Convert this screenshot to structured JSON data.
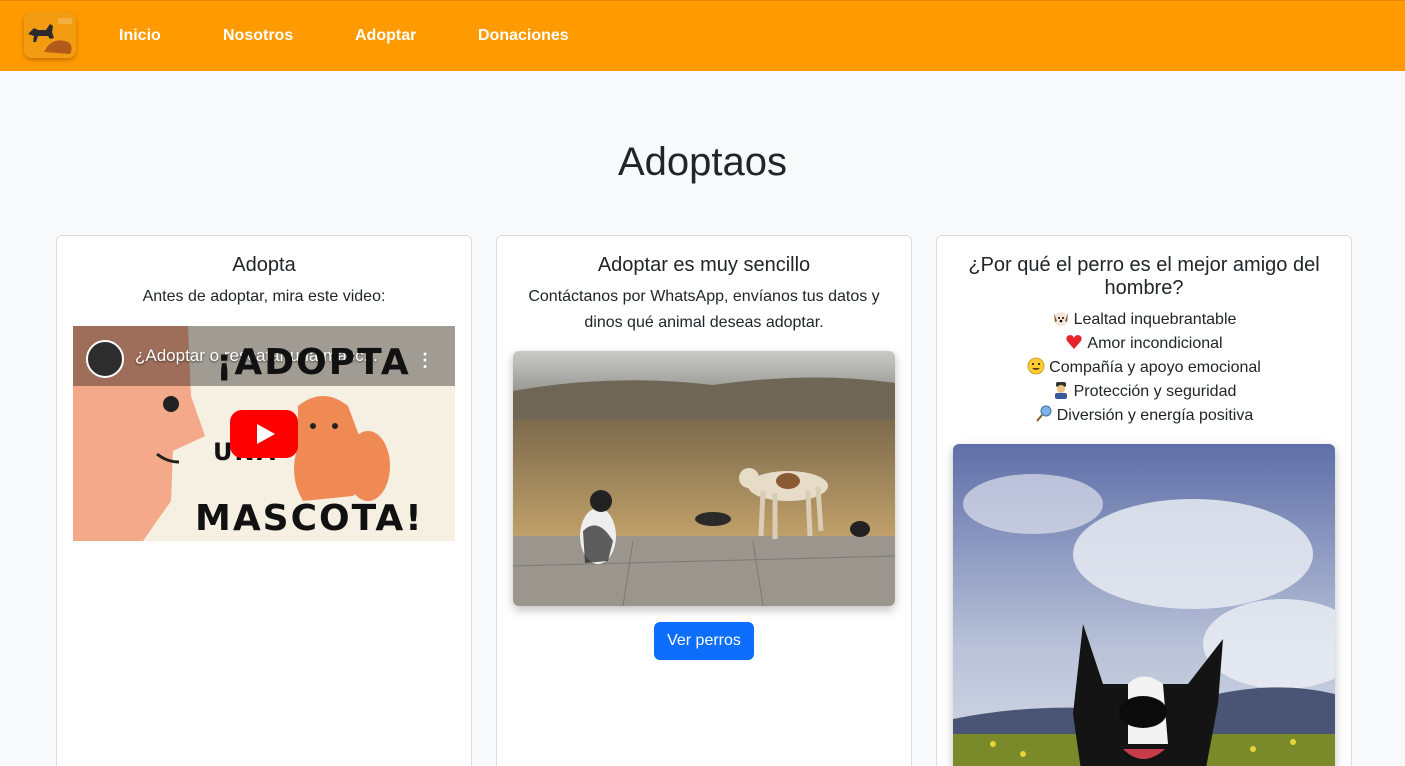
{
  "navbar": {
    "brand_icon": "dog-logo",
    "links": [
      "Inicio",
      "Nosotros",
      "Adoptar",
      "Donaciones"
    ]
  },
  "page": {
    "title": "Adoptaos"
  },
  "cards": [
    {
      "title": "Adopta",
      "text": "Antes de adoptar, mira este video:",
      "video": {
        "overlay_title": "¿Adoptar o rescatar una masc...",
        "line1": "¡ADOPTA",
        "line2": "UNA",
        "line3": "MASCOTA!"
      }
    },
    {
      "title": "Adoptar es muy sencillo",
      "text": "Contáctanos por WhatsApp, envíanos tus datos y dinos qué animal deseas adoptar.",
      "button": "Ver perros"
    },
    {
      "title": "¿Por qué el perro es el mejor amigo del hombre?",
      "benefits": [
        {
          "icon": "dog-face-icon",
          "text": "Lealtad inquebrantable"
        },
        {
          "icon": "heart-icon",
          "text": "Amor incondicional"
        },
        {
          "icon": "smile-icon",
          "text": "Compañía y apoyo emocional"
        },
        {
          "icon": "guard-icon",
          "text": "Protección y seguridad"
        },
        {
          "icon": "ball-icon",
          "text": "Diversión y energía positiva"
        }
      ]
    }
  ],
  "colors": {
    "navbar": "#ff9a00",
    "button": "#0d6efd",
    "play": "#ff0000"
  }
}
